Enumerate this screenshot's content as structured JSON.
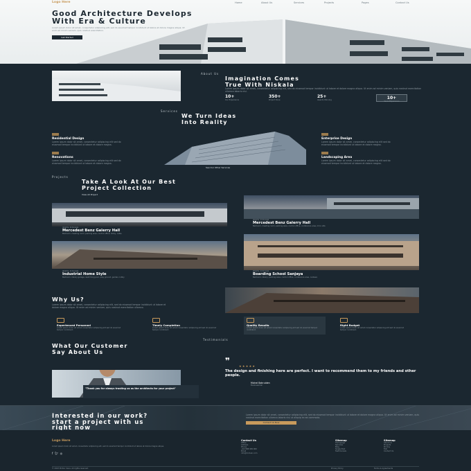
{
  "nav": {
    "logo": "Logo Here",
    "items": [
      "Home",
      "About Us",
      "Services",
      "Projects",
      "Pages",
      "Contact Us"
    ]
  },
  "hero": {
    "title_line1": "Good Architecture Develops",
    "title_line2": "With Era & Culture",
    "body": "Lorem ipsum dolor sit amet, consectetur adipiscing elit, sed do eiusmod tempor incididunt ut labore et dolore magna aliqua. Ut enim ad minim veniam, quis nostrud exercitation.",
    "cta": "Get Started"
  },
  "about": {
    "eyebrow": "About Us",
    "title_line1": "Imagination Comes",
    "title_line2": "True With Niskala",
    "body": "Lorem ipsum dolor sit amet, consectetur adipiscing elit, sed do eiusmod tempor incididunt ut labore et dolore magna aliqua. Ut enim ad minim veniam, quis nostrud exercitation ullamco laboris nisi.",
    "stats": [
      {
        "value": "10+",
        "label": "Our Experience"
      },
      {
        "value": "350+",
        "label": "Project Done"
      },
      {
        "value": "25+",
        "label": "Awards Winning"
      },
      {
        "value": "10+",
        "label": "Years Experience"
      }
    ]
  },
  "services": {
    "eyebrow": "Services",
    "title_line1": "We Turn Ideas",
    "title_line2": "Into Reality",
    "see_all": "See Our Other Services",
    "items": [
      {
        "tag": "01",
        "title": "Residential Design",
        "body": "Lorem ipsum dolor sit amet, consectetur adipiscing elit sed do eiusmod tempor incididunt ut labore et dolore magna."
      },
      {
        "tag": "02",
        "title": "Renovations",
        "body": "Lorem ipsum dolor sit amet, consectetur adipiscing elit sed do eiusmod tempor incididunt ut labore et dolore magna."
      },
      {
        "tag": "03",
        "title": "Enterprise Design",
        "body": "Lorem ipsum dolor sit amet, consectetur adipiscing elit sed do eiusmod tempor incididunt ut labore et dolore magna."
      },
      {
        "tag": "04",
        "title": "Landscaping Area",
        "body": "Lorem ipsum dolor sit amet, consectetur adipiscing elit sed do eiusmod tempor incididunt ut labore et dolore magna."
      }
    ]
  },
  "projects": {
    "eyebrow": "Projects",
    "title_line1": "Take A Look At Our Best",
    "title_line2": "Project Collection",
    "view_all": "View All Project",
    "items": [
      {
        "meta": "Jakarta, Indonesia",
        "title": "Mercedest Benz Galerry Hall",
        "body": "Bedroom, meeting room, parking area, control office, lobby, cafes"
      },
      {
        "meta": "Jakarta, Indonesia",
        "title": "Mercedest Benz Galerry Hall",
        "body": "Bedroom, meeting room, parking area, control office, conference area, mini cafe"
      },
      {
        "meta": "Jakarta, Indonesia",
        "title": "Industrial Home Style",
        "body": "Bedroom, library garage, swimming pool, play ground, garden, lobby"
      },
      {
        "meta": "Jakarta, Indonesia",
        "title": "Boarding School Sanjaya",
        "body": "Bedroom, library, parking area, control office, conference area, canteen"
      }
    ]
  },
  "why": {
    "title": "Why Us?",
    "body": "Lorem ipsum dolor sit amet, consectetur adipiscing elit, sed do eiusmod tempor incididunt ut labore et dolore magna aliqua. Ut enim ad minim veniam, quis nostrud exercitation ullamco.",
    "features": [
      {
        "title": "Experienced Personnel",
        "body": "Lorem ipsum dolor sit amet consectetur adipiscing elit sed do eiusmod tempor incididunt."
      },
      {
        "title": "Timely Completion",
        "body": "Lorem ipsum dolor sit amet consectetur adipiscing elit sed do eiusmod tempor incididunt."
      },
      {
        "title": "Quality Results",
        "body": "Lorem ipsum dolor sit amet consectetur adipiscing elit sed do eiusmod tempor incididunt."
      },
      {
        "title": "Right Budget",
        "body": "Lorem ipsum dolor sit amet consectetur adipiscing elit sed do eiusmod tempor incididunt."
      }
    ]
  },
  "testimonials": {
    "eyebrow": "Testimonials",
    "title_line1": "What Our Customer",
    "title_line2": "Say About Us",
    "caption": "\"Thank you for always trusting us as the architects for your project\"",
    "quote": "The design and finishing here are perfect. I want to recommend them to my friends and other people.",
    "author": "Michel Bahruiden",
    "author_role": "Businessman",
    "stars": "★ ★ ★ ★ ★"
  },
  "cta": {
    "title_line1": "Interested in our work?",
    "title_line2": "start a project with us",
    "title_line3": "right now",
    "body": "Lorem ipsum dolor sit amet, consectetur adipiscing elit, sed do eiusmod tempor incididunt ut labore et dolore magna aliqua. Ut enim ad minim veniam, quis nostrud exercitation ullamco laboris nisi ut aliquip ex ea commodo.",
    "button": "Contact Us Now"
  },
  "footer": {
    "logo": "Logo Here",
    "about": "Lorem ipsum dolor sit amet, consectetur adipiscing elit, sed do eiusmod tempor incididunt ut labore et dolore magna aliqua.",
    "contact_title": "Contact Us",
    "contact": [
      "Office",
      "Address",
      "Phone",
      "+62 888 999 000",
      "Email",
      "info@domain.com"
    ],
    "sitemap1_title": "Sitemap",
    "sitemap1": [
      "Homepage",
      "Services",
      "Blog",
      "Single Post",
      "Testimonials"
    ],
    "sitemap2_title": "Sitemap",
    "sitemap2": [
      "About Us",
      "Projects",
      "Pricing",
      "FAQ",
      "Contact Us"
    ],
    "copyright": "© 2023 Proton Cana. All rights reserved.",
    "legal": [
      "Privacy Policy",
      "Terms & Agreements"
    ],
    "social": [
      "facebook-icon",
      "twitter-icon",
      "instagram-icon"
    ]
  },
  "colors": {
    "accent": "#c89a5c",
    "dark": "#1b2730",
    "panel": "#26333c"
  }
}
